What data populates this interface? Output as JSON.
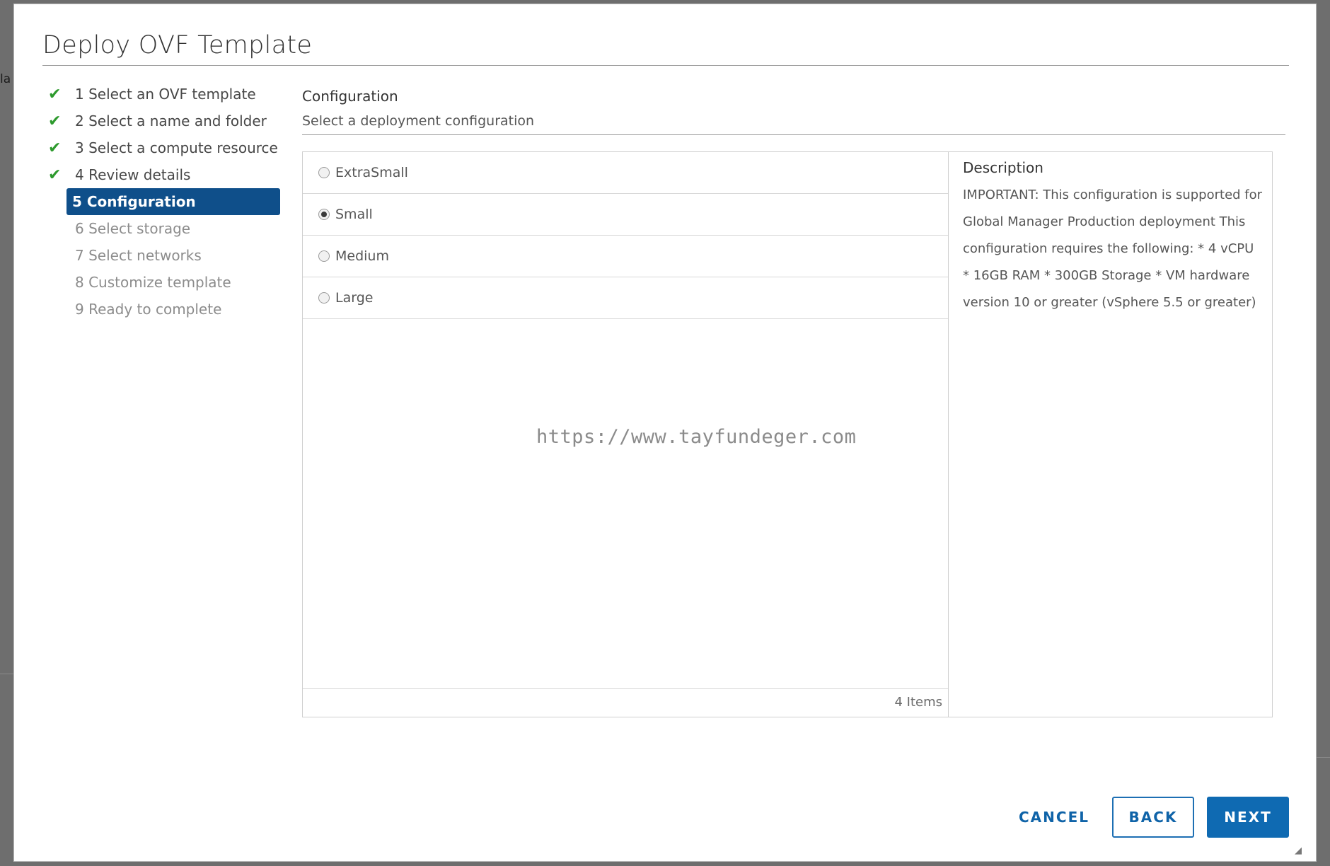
{
  "dialog": {
    "title": "Deploy OVF Template"
  },
  "steps": [
    {
      "label": "1 Select an OVF template",
      "state": "done"
    },
    {
      "label": "2 Select a name and folder",
      "state": "done"
    },
    {
      "label": "3 Select a compute resource",
      "state": "done"
    },
    {
      "label": "4 Review details",
      "state": "done"
    },
    {
      "label": "5 Configuration",
      "state": "current"
    },
    {
      "label": "6 Select storage",
      "state": "pending"
    },
    {
      "label": "7 Select networks",
      "state": "pending"
    },
    {
      "label": "8 Customize template",
      "state": "pending"
    },
    {
      "label": "9 Ready to complete",
      "state": "pending"
    }
  ],
  "section": {
    "title": "Configuration",
    "subtitle": "Select a deployment configuration"
  },
  "options": [
    {
      "label": "ExtraSmall",
      "selected": false
    },
    {
      "label": "Small",
      "selected": true
    },
    {
      "label": "Medium",
      "selected": false
    },
    {
      "label": "Large",
      "selected": false
    }
  ],
  "list_footer": "4 Items",
  "watermark": "https://www.tayfundeger.com",
  "description": {
    "title": "Description",
    "text": "IMPORTANT: This configuration is supported for Global Manager Production deployment This configuration requires the following: * 4 vCPU * 16GB RAM * 300GB Storage * VM hardware version 10 or greater (vSphere 5.5 or greater)"
  },
  "buttons": {
    "cancel": "CANCEL",
    "back": "BACK",
    "next": "NEXT"
  },
  "icons": {
    "check": "check-icon",
    "radio": "radio-icon",
    "resize": "resize-grip-icon"
  },
  "colors": {
    "accent": "#0f6ab2",
    "current_step": "#0f4f8a",
    "check": "#2d9a2d"
  }
}
